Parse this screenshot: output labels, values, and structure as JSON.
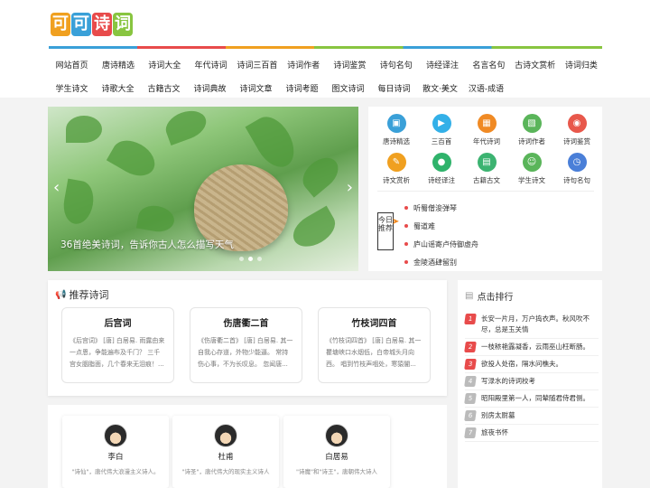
{
  "logo": {
    "chars": [
      "可",
      "可",
      "诗",
      "词"
    ],
    "colors": [
      "#f0a020",
      "#3aa0d8",
      "#e84b4b",
      "#88c540"
    ]
  },
  "nav": {
    "row1": [
      "网站首页",
      "唐诗精选",
      "诗词大全",
      "年代诗词",
      "诗词三百首",
      "诗词作者",
      "诗词鉴赏",
      "诗句名句",
      "诗经译注",
      "名言名句",
      "古诗文赏析",
      "诗词归类"
    ],
    "row2": [
      "学生诗文",
      "诗歌大全",
      "古籍古文",
      "诗词典故",
      "诗词文章",
      "诗词考题",
      "图文诗词",
      "每日诗词",
      "散文·美文",
      "汉语-成语"
    ]
  },
  "banner": {
    "caption": "36首绝美诗词，告诉你古人怎么描写天气",
    "prev_icon": "chevron-left-icon",
    "next_icon": "chevron-right-icon"
  },
  "categories": [
    {
      "label": "唐诗精选",
      "icon": "book-icon",
      "color": "#3aa0d8"
    },
    {
      "label": "三百首",
      "icon": "play-icon",
      "color": "#33b0e8"
    },
    {
      "label": "年代诗词",
      "icon": "calendar-icon",
      "color": "#f08a24"
    },
    {
      "label": "诗词作者",
      "icon": "image-icon",
      "color": "#5ab55a"
    },
    {
      "label": "诗词鉴赏",
      "icon": "location-icon",
      "color": "#e8584b"
    },
    {
      "label": "诗文赏析",
      "icon": "edit-icon",
      "color": "#f0a020"
    },
    {
      "label": "诗经译注",
      "icon": "chat-icon",
      "color": "#2fb36b"
    },
    {
      "label": "古籍古文",
      "icon": "scroll-icon",
      "color": "#3cb371"
    },
    {
      "label": "学生诗文",
      "icon": "student-icon",
      "color": "#5ab55a"
    },
    {
      "label": "诗句名句",
      "icon": "clock-icon",
      "color": "#4a7fd8"
    }
  ],
  "daily": {
    "badge": "今日推荐",
    "items": [
      "听蜀僧浚弹琴",
      "蜀道难",
      "庐山谣寄卢侍御虚舟",
      "金陵酒肆留别"
    ]
  },
  "recommend": {
    "title": "推荐诗词",
    "cards": [
      {
        "title": "后宫词",
        "text": "《后宫词》 [唐] 白居易. 雨露由来一点恩，争能遍布及千门？ 三千宫女胭脂面，几个春来无泪痕！..."
      },
      {
        "title": "伤唐衢二首",
        "text": "《伤唐衢二首》 [唐] 白居易. 其一 自我心存道，外物少能逼。 常持伤心事，不为长叹息。 忽闻唐..."
      },
      {
        "title": "竹枝词四首",
        "text": "《竹枝词四首》 [唐] 白居易. 其一 瞿塘峡口水烟低，白帝城头月向西。 唱到竹枝声咽处，寒猿闇..."
      }
    ]
  },
  "authors": [
    {
      "name": "李白",
      "desc": "\"诗仙\"，唐代伟大浪漫主义诗人。"
    },
    {
      "name": "杜甫",
      "desc": "\"诗圣\"，唐代伟大的现实主义诗人"
    },
    {
      "name": "白居易",
      "desc": "\"诗魔\"和\"诗王\"，唐朝伟大诗人"
    }
  ],
  "ranking": {
    "title": "点击排行",
    "items": [
      {
        "n": "1",
        "text": "长安一片月，万户捣衣声。秋风吹不尽，总是玉关情"
      },
      {
        "n": "2",
        "text": "一枝秾艳露凝香，云雨巫山枉断肠。"
      },
      {
        "n": "3",
        "text": "欲投人处宿，隔水问樵夫。"
      },
      {
        "n": "4",
        "text": "写渌水的诗词校考"
      },
      {
        "n": "5",
        "text": "昭阳殿里第一人，同辇随君侍君侧。"
      },
      {
        "n": "6",
        "text": "别房太尉墓"
      },
      {
        "n": "7",
        "text": "旅夜书怀"
      }
    ],
    "top_colors": [
      "#e84b4b",
      "#e84b4b",
      "#e84b4b"
    ],
    "other_color": "#bbbbbb"
  }
}
